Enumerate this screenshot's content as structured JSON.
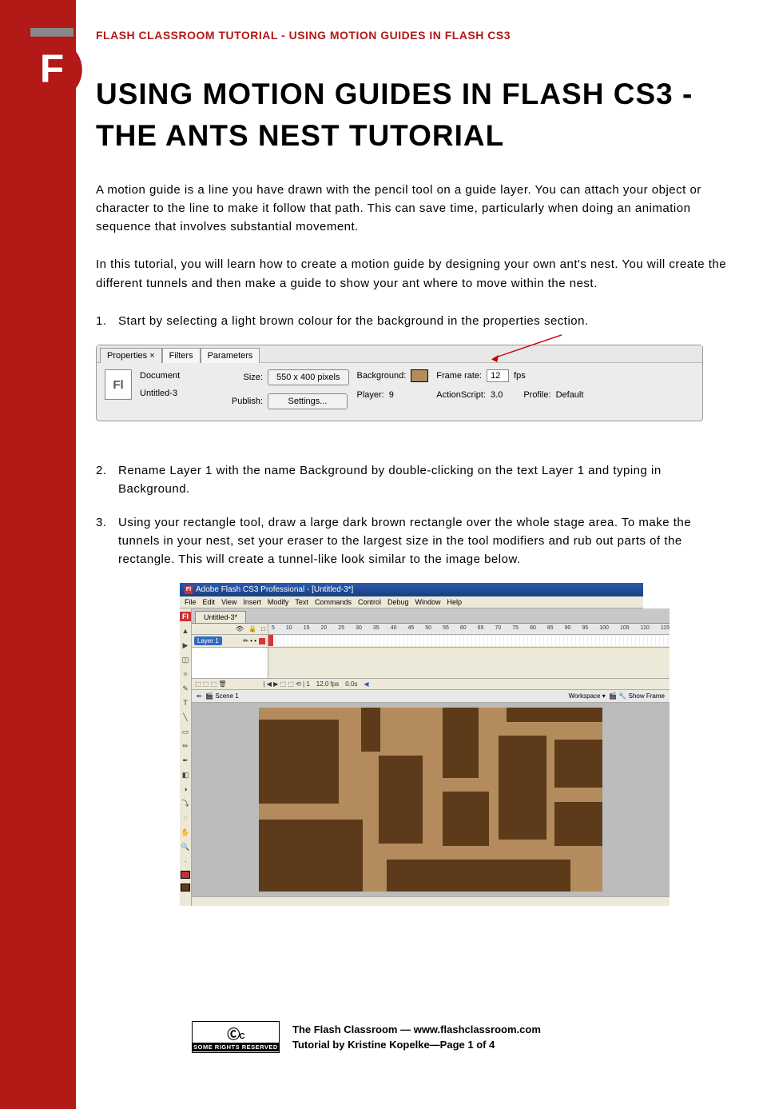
{
  "header": "FLASH CLASSROOM TUTORIAL  - USING MOTION GUIDES IN FLASH CS3",
  "title": "USING MOTION GUIDES IN FLASH CS3 - THE ANTS NEST TUTORIAL",
  "paras": {
    "p1": "A motion guide is a line you have drawn with the pencil tool on a guide layer.  You can attach your object or character to the line to make it follow that path.  This can save time, particularly when doing an animation sequence that involves substantial movement.",
    "p2": "In this tutorial, you will learn how to create a motion guide by designing your own ant's nest.    You will create the different tunnels and then make a guide to show your ant where to move within the nest."
  },
  "steps": {
    "s1": {
      "num": "1.",
      "text": "Start by selecting a light brown colour for the background in the properties section."
    },
    "s2": {
      "num": "2.",
      "text": "Rename Layer 1 with the name Background by double-clicking on the text Layer 1 and typing in Background."
    },
    "s3": {
      "num": "3.",
      "text": "Using your rectangle tool, draw a large dark brown rectangle over the whole stage area.    To make the tunnels in your nest, set your eraser to the largest size in the tool modifiers and rub out parts of the rectangle.  This will create a tunnel-like look similar to the image below."
    }
  },
  "props_panel": {
    "tabs": {
      "properties": "Properties ×",
      "filters": "Filters",
      "parameters": "Parameters"
    },
    "fl": "Fl",
    "document": "Document",
    "untitled": "Untitled-3",
    "size_lbl": "Size:",
    "size_btn": "550 x 400 pixels",
    "publish_lbl": "Publish:",
    "publish_btn": "Settings...",
    "bg_lbl": "Background:",
    "player_lbl": "Player:",
    "player_val": "9",
    "fr_lbl": "Frame rate:",
    "fr_val": "12",
    "fps": "fps",
    "as_lbl": "ActionScript:",
    "as_val": "3.0",
    "profile_lbl": "Profile:",
    "profile_val": "Default"
  },
  "flash_window": {
    "titlebar": "Adobe Flash CS3 Professional - [Untitled-3*]",
    "menus": [
      "File",
      "Edit",
      "View",
      "Insert",
      "Modify",
      "Text",
      "Commands",
      "Control",
      "Debug",
      "Window",
      "Help"
    ],
    "doc_tab": "Untitled-3*",
    "layer_name": "Layer 1",
    "ruler_marks": [
      "5",
      "10",
      "15",
      "20",
      "25",
      "30",
      "35",
      "40",
      "45",
      "50",
      "55",
      "60",
      "65",
      "70",
      "75",
      "80",
      "85",
      "90",
      "95",
      "100",
      "105",
      "110",
      "115"
    ],
    "fps": "12.0 fps",
    "time": "0.0s",
    "scene": "Scene 1",
    "workspace": "Workspace ▾",
    "show_frame": "Show Frame"
  },
  "footer": {
    "cc_top": "ⓒⓒ",
    "cc_symbol": "cc",
    "cc_bot": "SOME RIGHTS RESERVED",
    "line1": "The Flash Classroom — www.flashclassroom.com",
    "line2": "Tutorial by Kristine Kopelke—Page 1 of 4"
  }
}
